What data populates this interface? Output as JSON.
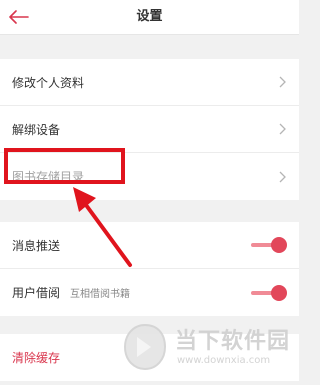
{
  "header": {
    "title": "设置"
  },
  "settings_group": {
    "items": [
      {
        "label": "修改个人资料"
      },
      {
        "label": "解绑设备"
      },
      {
        "label": "图书存储目录"
      }
    ]
  },
  "toggles_group": {
    "push": {
      "label": "消息推送",
      "enabled": true
    },
    "borrow": {
      "label": "用户借阅",
      "sub": "互相借阅书籍",
      "enabled": true
    }
  },
  "cache_group": {
    "clear_label": "清除缓存"
  },
  "watermark": {
    "name": "当下软件园",
    "url": "www.downxia.com"
  },
  "colors": {
    "accent": "#e2475a",
    "annotation": "#e0141d"
  }
}
